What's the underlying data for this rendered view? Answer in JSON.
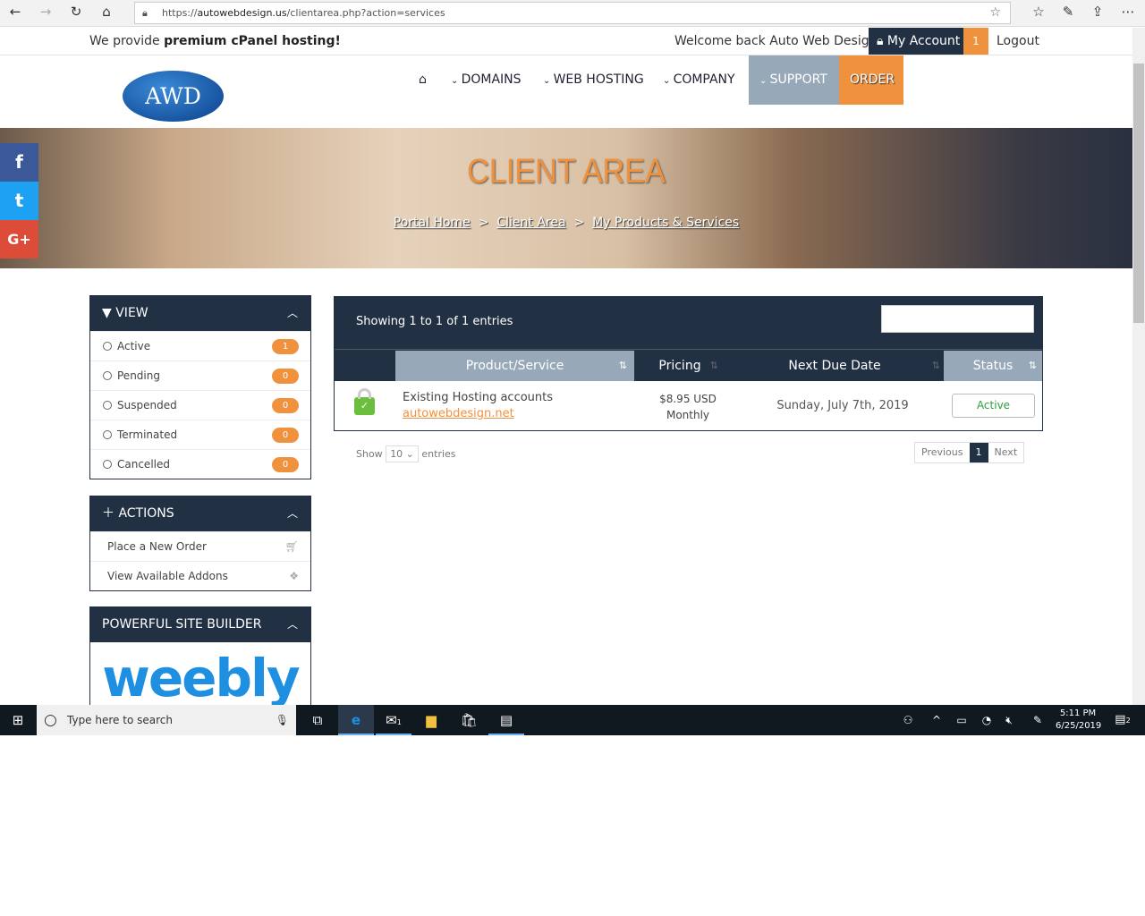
{
  "browser": {
    "url_prefix": "https://",
    "url_domain": "autowebdesign.us",
    "url_path": "/clientarea.php?action=services"
  },
  "topbar": {
    "tagline_pre": "We provide ",
    "tagline_bold": "premium cPanel hosting!",
    "welcome": "Welcome back Auto Web Design!",
    "my_account": "My Account",
    "notification_count": "1",
    "logout": "Logout"
  },
  "logo": {
    "text": "AWD"
  },
  "nav": {
    "domains": "DOMAINS",
    "web_hosting": "WEB HOSTING",
    "company": "COMPANY",
    "support": "SUPPORT",
    "order": "ORDER"
  },
  "hero": {
    "title": "CLIENT AREA",
    "breadcrumb": [
      "Portal Home",
      "Client Area",
      "My Products & Services"
    ],
    "sep": ">"
  },
  "social": {
    "facebook": "f",
    "twitter": "t",
    "google": "G+"
  },
  "view_panel": {
    "title": "VIEW",
    "items": [
      {
        "label": "Active",
        "count": "1"
      },
      {
        "label": "Pending",
        "count": "0"
      },
      {
        "label": "Suspended",
        "count": "0"
      },
      {
        "label": "Terminated",
        "count": "0"
      },
      {
        "label": "Cancelled",
        "count": "0"
      }
    ]
  },
  "actions_panel": {
    "title": "ACTIONS",
    "items": [
      {
        "label": "Place a New Order"
      },
      {
        "label": "View Available Addons"
      }
    ]
  },
  "builder_panel": {
    "title": "POWERFUL SITE BUILDER",
    "logo": "weebly"
  },
  "table": {
    "showing": "Showing 1 to 1 of 1 entries",
    "search_value": "",
    "columns": [
      "Product/Service",
      "Pricing",
      "Next Due Date",
      "Status"
    ],
    "rows": [
      {
        "product": "Existing Hosting accounts",
        "domain": "autowebdesign.net",
        "price": "$8.95 USD",
        "cycle": "Monthly",
        "due": "Sunday, July 7th, 2019",
        "status": "Active"
      }
    ],
    "show_label": "Show",
    "page_size": "10",
    "entries_label": "entries",
    "prev": "Previous",
    "page": "1",
    "next": "Next"
  },
  "taskbar": {
    "search_placeholder": "Type here to search",
    "time": "5:11 PM",
    "date": "6/25/2019",
    "mail_badge": "1",
    "notif_badge": "2"
  },
  "colors": {
    "navy": "#223044",
    "orange": "#f0913e",
    "steel": "#97a9b9",
    "green": "#2e9e3e"
  }
}
